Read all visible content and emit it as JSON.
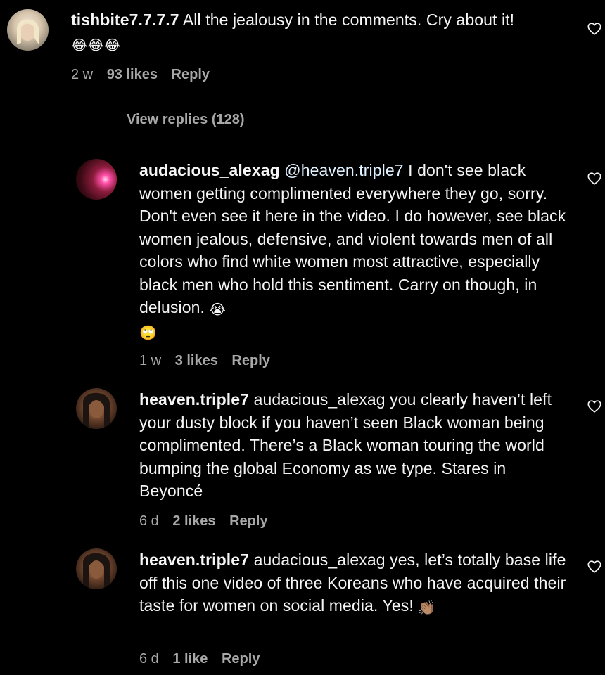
{
  "comments": [
    {
      "username": "tishbite7.7.7.7",
      "body": "All the jealousy in the comments. Cry about it!",
      "emoji": "😂😂😂",
      "time": "2 w",
      "likes": "93 likes",
      "reply": "Reply"
    },
    {
      "username": "audacious_alexag",
      "mention": "@heaven.triple7",
      "body": "I don't see black women getting complimented everywhere they go, sorry. Don't even see it here in the video. I do however, see black women jealous, defensive, and violent towards men of all colors who find white women most attractive, especially black men who hold this sentiment. Carry on though, in delusion.",
      "emoji1": "😭",
      "emoji2": "🙄",
      "time": "1 w",
      "likes": "3 likes",
      "reply": "Reply"
    },
    {
      "username": "heaven.triple7",
      "body": "audacious_alexag you clearly haven’t left your dusty block if you haven’t seen Black woman being complimented. There’s a Black woman touring the world bumping the global Economy as we type. Stares in Beyoncé",
      "time": "6 d",
      "likes": "2 likes",
      "reply": "Reply"
    },
    {
      "username": "heaven.triple7",
      "body": "audacious_alexag yes, let’s totally base life off this one video of three Koreans who have acquired their taste for women on social media. Yes!",
      "emoji": "👏🏽",
      "time": "6 d",
      "likes": "1 like",
      "reply": "Reply"
    }
  ],
  "view_replies": "View replies (128)",
  "icons": {
    "like": "heart-outline-icon"
  },
  "colors": {
    "background": "#000000",
    "text": "#f5f5f5",
    "secondary": "#a8a8a8"
  }
}
